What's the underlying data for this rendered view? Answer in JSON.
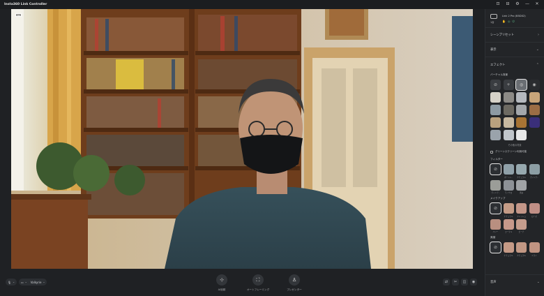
{
  "app": {
    "title": "Insta360 Link Controller",
    "window_controls": [
      "⊡",
      "⊟",
      "⚙",
      "—",
      "✕"
    ]
  },
  "video": {
    "hd_badge": "HD"
  },
  "toolbar": {
    "mic_icon": "microphone-icon",
    "camera_source": "Valkyrie",
    "tools": [
      {
        "icon": "ai-tracking-icon",
        "glyph": "⊹",
        "label": "AI追跡"
      },
      {
        "icon": "auto-frame-icon",
        "glyph": "⛶",
        "label": "オートフレーミング"
      },
      {
        "icon": "presenter-icon",
        "glyph": "♙",
        "label": "プレゼンター"
      }
    ],
    "right_icons": [
      "⇄",
      "✂",
      "◫",
      "◉"
    ]
  },
  "panel": {
    "device": {
      "name": "Link 2 Pro (B5D02)",
      "cam_num": "1台"
    },
    "sections": {
      "scene_presets": "シーンプリセット",
      "display": "表示",
      "effects": "エフェクト",
      "audio": "音声"
    },
    "virtual_bg": {
      "label": "バーチャル背景",
      "more": "その他の背景",
      "greenscreen": "グリーンスクリーン利用可能"
    },
    "filters": {
      "label": "フィルター",
      "items": [
        "",
        "ポートレ..",
        "ナチュラル",
        "ヴィンテ..",
        "ヴィンテ..",
        "モノクロ",
        "黒白"
      ]
    },
    "makeup": {
      "label": "メイクアップ",
      "items": [
        "",
        "ナチュラル",
        "フレッシュ",
        "ローズ",
        "ベリー",
        "コーラル",
        "ピーチ"
      ]
    },
    "beauty": {
      "label": "美顔",
      "items": [
        "",
        "ナチュラル",
        "ナチュラル",
        "ドライ"
      ]
    }
  },
  "colors": {
    "accent": "#5fbf8a",
    "panel_bg": "#232528",
    "app_bg": "#1f2124"
  }
}
